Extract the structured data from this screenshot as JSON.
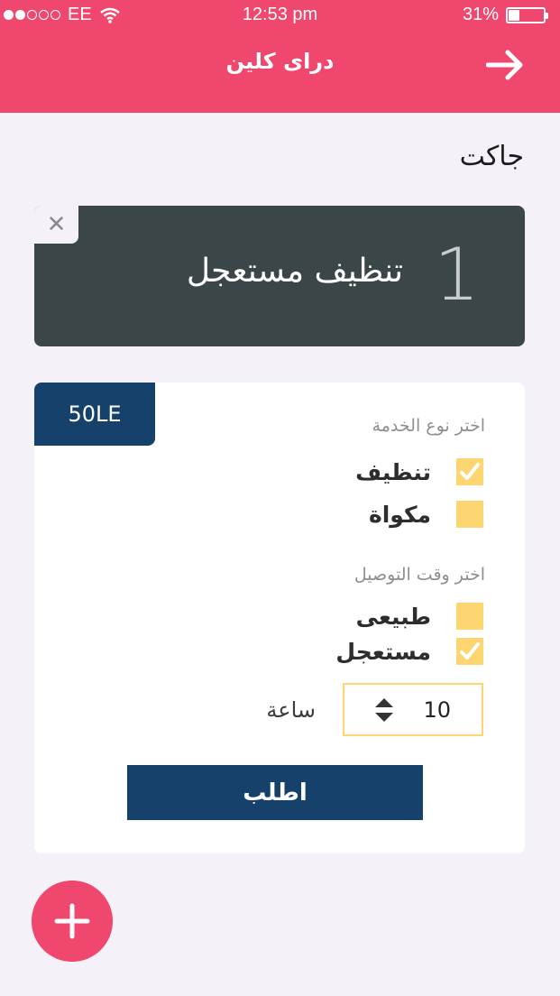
{
  "status_bar": {
    "carrier": "EE",
    "time": "12:53 pm",
    "battery": "31%",
    "signal_filled": 2,
    "signal_total": 5,
    "battery_level": 0.31
  },
  "header": {
    "title": "دراى كلين",
    "back_icon": "arrow-right-icon"
  },
  "item_title": "جاكت",
  "summary_card": {
    "number": "1",
    "service": "تنظيف مستعجل",
    "close_icon": "close-icon"
  },
  "order_card": {
    "price": "50LE",
    "service_type_label": "اختر نوع الخدمة",
    "service_options": [
      {
        "label": "تنظيف",
        "checked": true
      },
      {
        "label": "مكواة",
        "checked": false
      }
    ],
    "delivery_label": "اختر وقت التوصيل",
    "delivery_options": [
      {
        "label": "طبيعى",
        "checked": false
      },
      {
        "label": "مستعجل",
        "checked": true
      }
    ],
    "hours_label": "ساعة",
    "hours_value": "10",
    "submit_label": "اطلب"
  },
  "fab_icon": "plus-icon",
  "colors": {
    "primary": "#f0476f",
    "navy": "#16416b",
    "dark_card": "#3a4647",
    "checkbox": "#fdd571",
    "background": "#f4f2f8"
  }
}
